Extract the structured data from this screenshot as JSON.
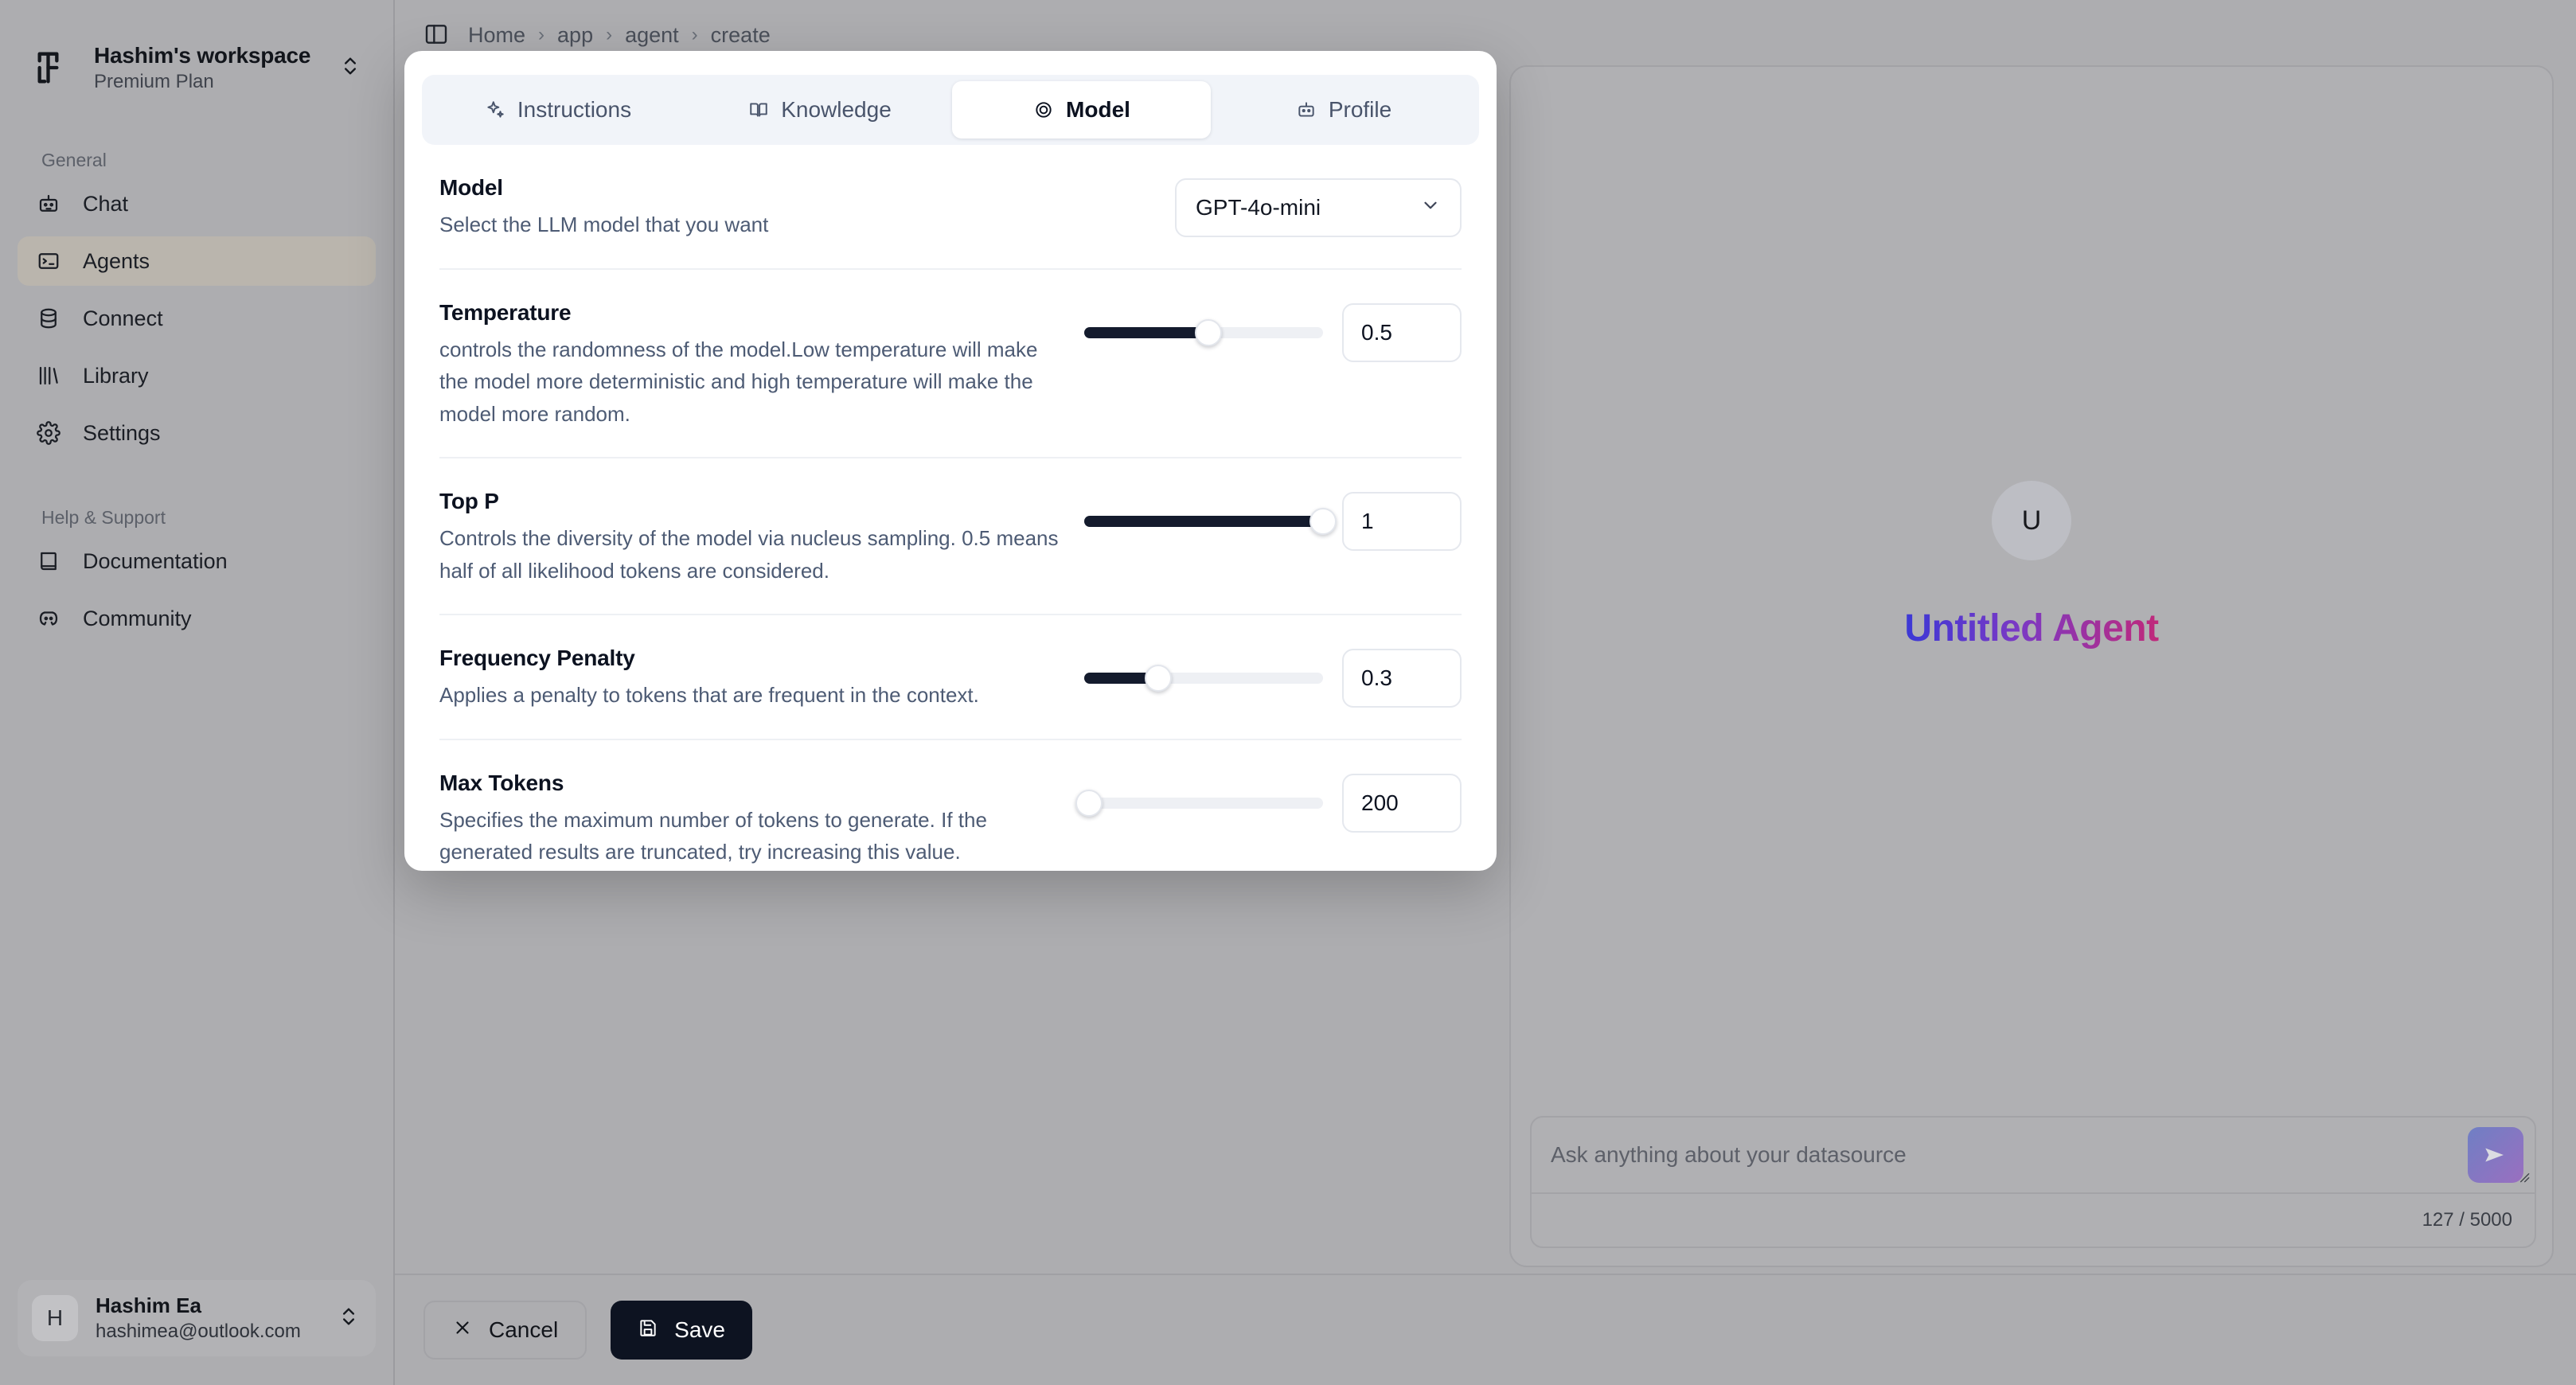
{
  "sidebar": {
    "workspace": {
      "name": "Hashim's workspace",
      "plan": "Premium Plan",
      "logo_icon": "workspace-logo-icon",
      "switch_icon": "chevron-up-down-icon"
    },
    "groups": [
      {
        "label": "General",
        "items": [
          {
            "label": "Chat",
            "icon": "bot-icon",
            "active": false
          },
          {
            "label": "Agents",
            "icon": "terminal-icon",
            "active": true
          },
          {
            "label": "Connect",
            "icon": "database-icon",
            "active": false
          },
          {
            "label": "Library",
            "icon": "library-icon",
            "active": false
          },
          {
            "label": "Settings",
            "icon": "gear-icon",
            "active": false
          }
        ]
      },
      {
        "label": "Help & Support",
        "items": [
          {
            "label": "Documentation",
            "icon": "book-icon",
            "active": false
          },
          {
            "label": "Community",
            "icon": "discord-icon",
            "active": false
          }
        ]
      }
    ],
    "user": {
      "initial": "H",
      "name": "Hashim Ea",
      "email": "hashimea@outlook.com",
      "switch_icon": "chevron-up-down-icon"
    }
  },
  "topbar": {
    "panel_toggle_icon": "sidebar-panel-icon",
    "breadcrumbs": [
      "Home",
      "app",
      "agent",
      "create"
    ],
    "separator": "›"
  },
  "modal": {
    "tabs": [
      {
        "label": "Instructions",
        "icon": "sparkles-icon",
        "active": false
      },
      {
        "label": "Knowledge",
        "icon": "book-open-icon",
        "active": false
      },
      {
        "label": "Model",
        "icon": "brain-icon",
        "active": true
      },
      {
        "label": "Profile",
        "icon": "bot-icon",
        "active": false
      }
    ],
    "settings": [
      {
        "title": "Model",
        "description": "Select the LLM model that you want",
        "control": "select",
        "value": "GPT-4o-mini",
        "chevron_icon": "chevron-down-icon"
      },
      {
        "title": "Temperature",
        "description": "controls the randomness of the model.Low temperature will make the model more deterministic and high temperature will make the model more random.",
        "control": "slider",
        "value": "0.5",
        "percent": 52
      },
      {
        "title": "Top P",
        "description": "Controls the diversity of the model via nucleus sampling. 0.5 means half of all likelihood tokens are considered.",
        "control": "slider",
        "value": "1",
        "percent": 100
      },
      {
        "title": "Frequency Penalty",
        "description": "Applies a penalty to tokens that are frequent in the context.",
        "control": "slider",
        "value": "0.3",
        "percent": 31
      },
      {
        "title": "Max Tokens",
        "description": "Specifies the maximum number of tokens to generate. If the generated results are truncated, try increasing this value.",
        "control": "slider",
        "value": "200",
        "percent": 2
      }
    ]
  },
  "preview": {
    "avatar_initial": "U",
    "agent_name": "Untitled Agent",
    "composer": {
      "placeholder": "Ask anything about your datasource",
      "counter": "127 / 5000",
      "send_icon": "send-icon",
      "resize_icon": "resize-grip-icon"
    }
  },
  "footer": {
    "cancel_label": "Cancel",
    "cancel_icon": "close-icon",
    "save_label": "Save",
    "save_icon": "floppy-disk-icon"
  },
  "colors": {
    "accent_dark": "#0d1321",
    "slider_fill": "#141b2d",
    "gradient_start": "#3b38d6",
    "gradient_end": "#c0297a",
    "page_bg": "#adadb0"
  }
}
